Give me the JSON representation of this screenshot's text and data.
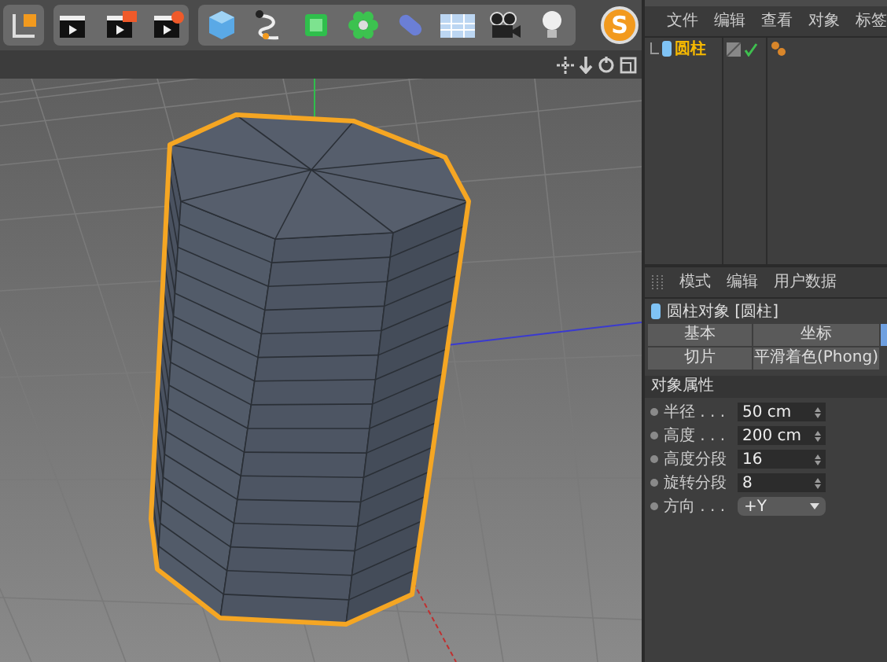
{
  "toolbar": {
    "badge": "S"
  },
  "object_manager": {
    "menu": [
      "文件",
      "编辑",
      "查看",
      "对象",
      "标签"
    ],
    "objects": [
      {
        "name": "圆柱",
        "selected": true,
        "enabled": true
      }
    ]
  },
  "attribute_manager": {
    "menu": [
      "模式",
      "编辑",
      "用户数据"
    ],
    "title": "圆柱对象 [圆柱]",
    "tabs": [
      {
        "label": "基本",
        "selected": false
      },
      {
        "label": "坐标",
        "selected": false
      },
      {
        "label": "切片",
        "selected": false
      },
      {
        "label": "平滑着色(Phong)",
        "selected": false
      }
    ],
    "section": "对象属性",
    "fields": [
      {
        "label": "半径 . . .",
        "value": "50 cm",
        "kind": "number"
      },
      {
        "label": "高度 . . .",
        "value": "200 cm",
        "kind": "number"
      },
      {
        "label": "高度分段",
        "value": "16",
        "kind": "number"
      },
      {
        "label": "旋转分段",
        "value": "8",
        "kind": "number"
      },
      {
        "label": "方向 . . .",
        "value": "+Y",
        "kind": "dropdown"
      }
    ]
  }
}
